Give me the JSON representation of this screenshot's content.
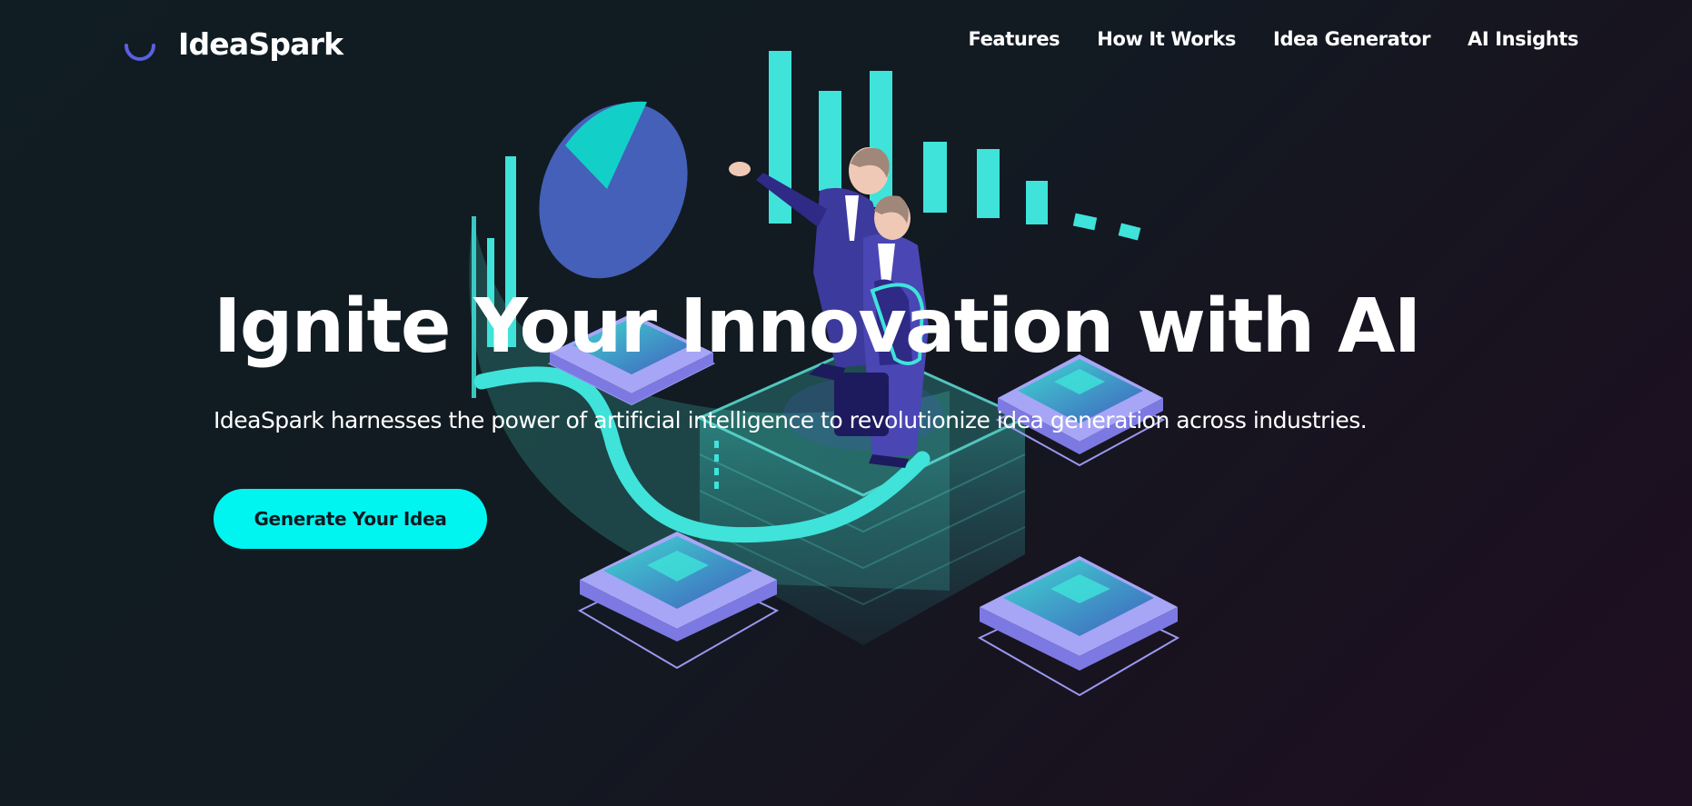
{
  "brand": {
    "name": "IdeaSpark",
    "icon": "spinner-arc-icon"
  },
  "nav": {
    "links": [
      {
        "label": "Features"
      },
      {
        "label": "How It Works"
      },
      {
        "label": "Idea Generator"
      },
      {
        "label": "AI Insights"
      }
    ]
  },
  "hero": {
    "title": "Ignite Your Innovation with AI",
    "subtitle": "IdeaSpark harnesses the power of artificial intelligence to revolutionize idea generation across industries.",
    "cta_label": "Generate Your Idea",
    "illustration": "isometric-business-analytics-illustration"
  },
  "colors": {
    "accent_cyan": "#00f5f0",
    "illustration_teal": "#3fe3da",
    "illustration_blue": "#4560b8",
    "illustration_violet": "#a7a5f5",
    "brand_icon_blue": "#5b5fe0",
    "background_dark": "#111b22"
  }
}
